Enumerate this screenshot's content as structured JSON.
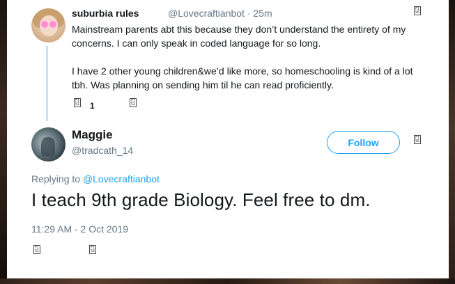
{
  "thread_tweet": {
    "author_name": "suburbia rules",
    "handle": "@Lovecraftianbot",
    "separator": "·",
    "age": "25m",
    "paragraphs": [
      "Mainstream parents abt this because they don’t understand the entirety of my concerns. I can only speak in coded language for so long.",
      "I have 2 other young children&we’d like more, so homeschooling is kind of a lot tbh. Was planning on sending him til he can read proficiently."
    ],
    "reply_count": "1",
    "menu_glyph": "F1 96",
    "action_glyph_1": "F1 51",
    "action_glyph_2": "F1 52"
  },
  "main_tweet": {
    "author_name": "Maggie",
    "handle": "@tradcath_14",
    "follow_label": "Follow",
    "replying_prefix": "Replying to",
    "replying_to": "@Lovecraftianbot",
    "text": "I teach 9th grade Biology. Feel free to dm.",
    "timestamp": "11:29 AM - 2 Oct 2019",
    "menu_glyph": "F1 96",
    "action_glyph_1": "F1 51",
    "action_glyph_2": "F1 52"
  },
  "colors": {
    "accent": "#1da1f2",
    "secondary_text": "#657786",
    "primary_text": "#14171a",
    "thread_line": "#c4e4f6"
  }
}
